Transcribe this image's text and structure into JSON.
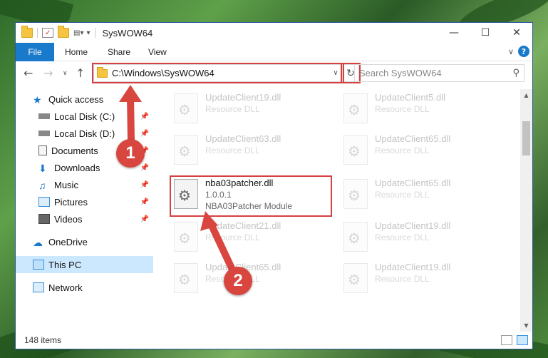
{
  "titlebar": {
    "title": "SysWOW64"
  },
  "ribbon": {
    "tabs": [
      "File",
      "Home",
      "Share",
      "View"
    ]
  },
  "nav": {
    "address": "C:\\Windows\\SysWOW64",
    "search_placeholder": "Search SysWOW64"
  },
  "sidebar": {
    "items": [
      {
        "label": "Quick access",
        "icon": "star-icon"
      },
      {
        "label": "Local Disk (C:)",
        "icon": "drive-icon"
      },
      {
        "label": "Local Disk (D:)",
        "icon": "drive-icon"
      },
      {
        "label": "Documents",
        "icon": "documents-icon"
      },
      {
        "label": "Downloads",
        "icon": "download-icon"
      },
      {
        "label": "Music",
        "icon": "music-icon"
      },
      {
        "label": "Pictures",
        "icon": "pictures-icon"
      },
      {
        "label": "Videos",
        "icon": "video-icon"
      },
      {
        "label": "OneDrive",
        "icon": "cloud-icon"
      },
      {
        "label": "This PC",
        "icon": "computer-icon"
      },
      {
        "label": "Network",
        "icon": "network-icon"
      }
    ]
  },
  "files": [
    {
      "name": "UpdateClient19.dll",
      "sub": "Resource DLL"
    },
    {
      "name": "UpdateClient5.dll",
      "sub": "Resource DLL"
    },
    {
      "name": "UpdateClient63.dll",
      "sub": "Resource DLL"
    },
    {
      "name": "UpdateClient65.dll",
      "sub": "Resource DLL"
    },
    {
      "name": "nba03patcher.dll",
      "version": "1.0.0.1",
      "desc": "NBA03Patcher Module"
    },
    {
      "name": "UpdateClient65.dll",
      "sub": "Resource DLL"
    },
    {
      "name": "UpdateClient21.dll",
      "sub": "Resource DLL"
    },
    {
      "name": "UpdateClient19.dll",
      "sub": "Resource DLL"
    },
    {
      "name": "UpdateClient65.dll",
      "sub": "Resource DLL"
    },
    {
      "name": "UpdateClient19.dll",
      "sub": "Resource DLL"
    }
  ],
  "status": {
    "count": "148 items"
  },
  "callouts": [
    "1",
    "2"
  ],
  "colors": {
    "accent": "#1979ca",
    "highlight": "#d64040",
    "selected": "#cce8ff"
  }
}
